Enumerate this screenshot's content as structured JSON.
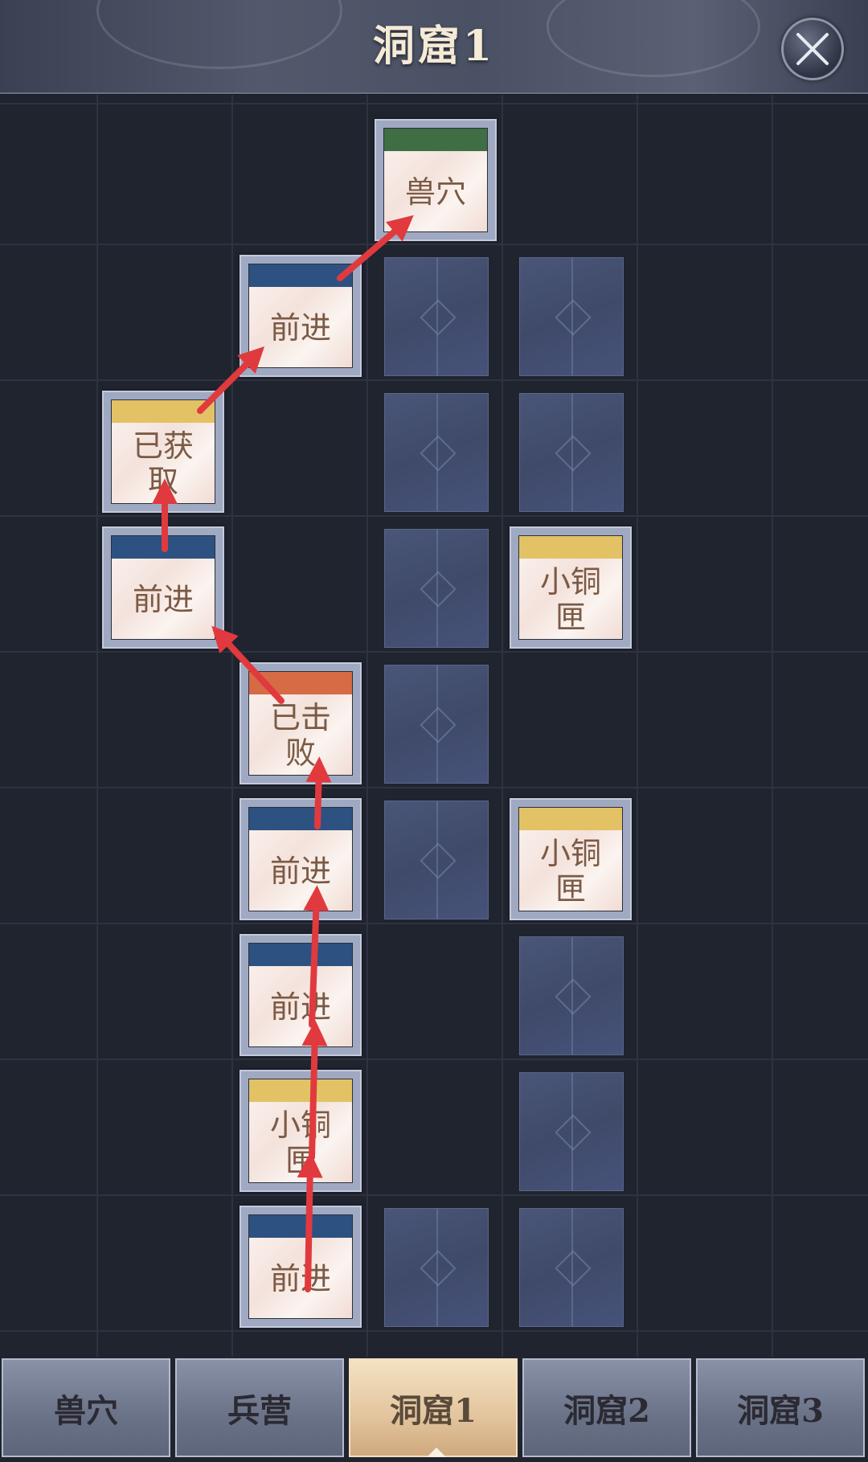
{
  "header": {
    "title": "洞窟1"
  },
  "cards": {
    "r0c3": {
      "label": "兽穴",
      "bar_color": "#3f6e45"
    },
    "r1c2": {
      "label": "前进",
      "bar_color": "#2d5282"
    },
    "r2c1": {
      "label": "已获取",
      "bar_color": "#e3c265"
    },
    "r3c1": {
      "label": "前进",
      "bar_color": "#2d5282"
    },
    "r3c4": {
      "label": "小铜匣",
      "bar_color": "#e3c265"
    },
    "r4c2": {
      "label": "已击败",
      "bar_color": "#d66b45"
    },
    "r5c2": {
      "label": "前进",
      "bar_color": "#2d5282"
    },
    "r5c4": {
      "label": "小铜匣",
      "bar_color": "#e3c265"
    },
    "r6c2": {
      "label": "前进",
      "bar_color": "#2d5282"
    },
    "r7c2": {
      "label": "小铜匣",
      "bar_color": "#e3c265"
    },
    "r8c2": {
      "label": "前进",
      "bar_color": "#2d5282"
    }
  },
  "tabs": [
    {
      "label": "兽穴",
      "active": false
    },
    {
      "label": "兵营",
      "active": false
    },
    {
      "label": "洞窟1",
      "active": true
    },
    {
      "label": "洞窟2",
      "active": false
    },
    {
      "label": "洞窟3",
      "active": false
    }
  ],
  "arrow_color": "#e03a3e"
}
